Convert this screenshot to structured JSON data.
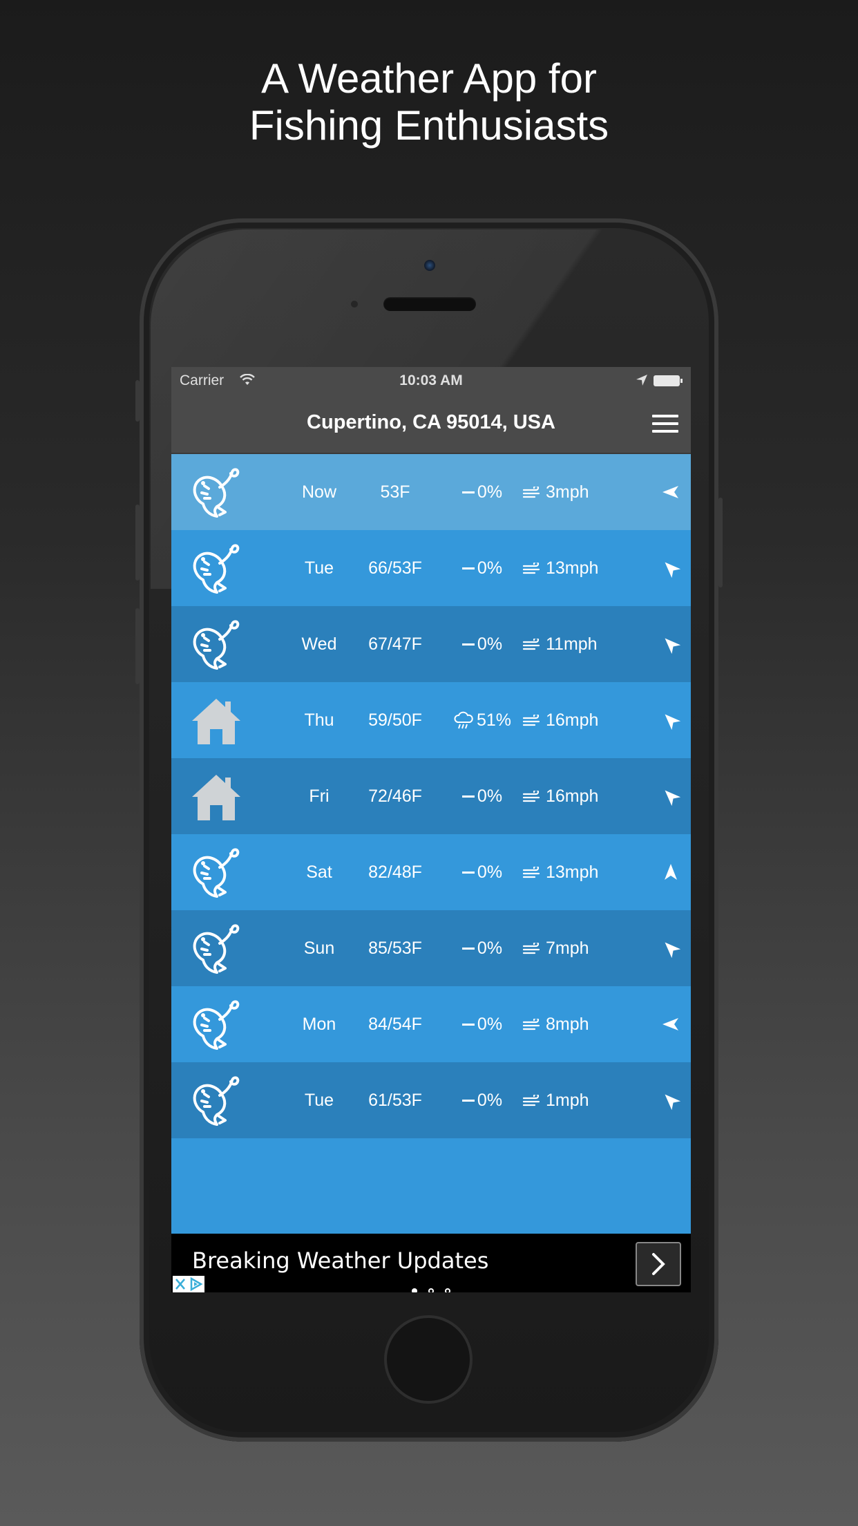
{
  "promo": {
    "headline_line1": "A Weather App for",
    "headline_line2": "Fishing Enthusiasts"
  },
  "status_bar": {
    "carrier": "Carrier",
    "time": "10:03 AM"
  },
  "nav": {
    "title": "Cupertino, CA 95014, USA"
  },
  "forecast": [
    {
      "day": "Now",
      "temp": "53F",
      "precip": "0%",
      "precip_icon": "dash-icon",
      "wind": "3mph",
      "status_icon": "fish-icon",
      "wind_dir_deg": 270
    },
    {
      "day": "Tue",
      "temp": "66/53F",
      "precip": "0%",
      "precip_icon": "dash-icon",
      "wind": "13mph",
      "status_icon": "fish-icon",
      "wind_dir_deg": 315
    },
    {
      "day": "Wed",
      "temp": "67/47F",
      "precip": "0%",
      "precip_icon": "dash-icon",
      "wind": "11mph",
      "status_icon": "fish-icon",
      "wind_dir_deg": 315
    },
    {
      "day": "Thu",
      "temp": "59/50F",
      "precip": "51%",
      "precip_icon": "rain-cloud-icon",
      "wind": "16mph",
      "status_icon": "house-icon",
      "wind_dir_deg": 315
    },
    {
      "day": "Fri",
      "temp": "72/46F",
      "precip": "0%",
      "precip_icon": "dash-icon",
      "wind": "16mph",
      "status_icon": "house-icon",
      "wind_dir_deg": 315
    },
    {
      "day": "Sat",
      "temp": "82/48F",
      "precip": "0%",
      "precip_icon": "dash-icon",
      "wind": "13mph",
      "status_icon": "fish-icon",
      "wind_dir_deg": 0
    },
    {
      "day": "Sun",
      "temp": "85/53F",
      "precip": "0%",
      "precip_icon": "dash-icon",
      "wind": "7mph",
      "status_icon": "fish-icon",
      "wind_dir_deg": 315
    },
    {
      "day": "Mon",
      "temp": "84/54F",
      "precip": "0%",
      "precip_icon": "dash-icon",
      "wind": "8mph",
      "status_icon": "fish-icon",
      "wind_dir_deg": 270
    },
    {
      "day": "Tue",
      "temp": "61/53F",
      "precip": "0%",
      "precip_icon": "dash-icon",
      "wind": "1mph",
      "status_icon": "fish-icon",
      "wind_dir_deg": 315
    }
  ],
  "ad": {
    "text": "Breaking Weather Updates",
    "page_count": 3,
    "active_page": 1
  },
  "colors": {
    "row_now": "#5ba9da",
    "row_light": "#3498db",
    "row_dark": "#2b80bb",
    "nav_bg": "#4a4a4a",
    "house_icon": "#cfd3d6"
  }
}
